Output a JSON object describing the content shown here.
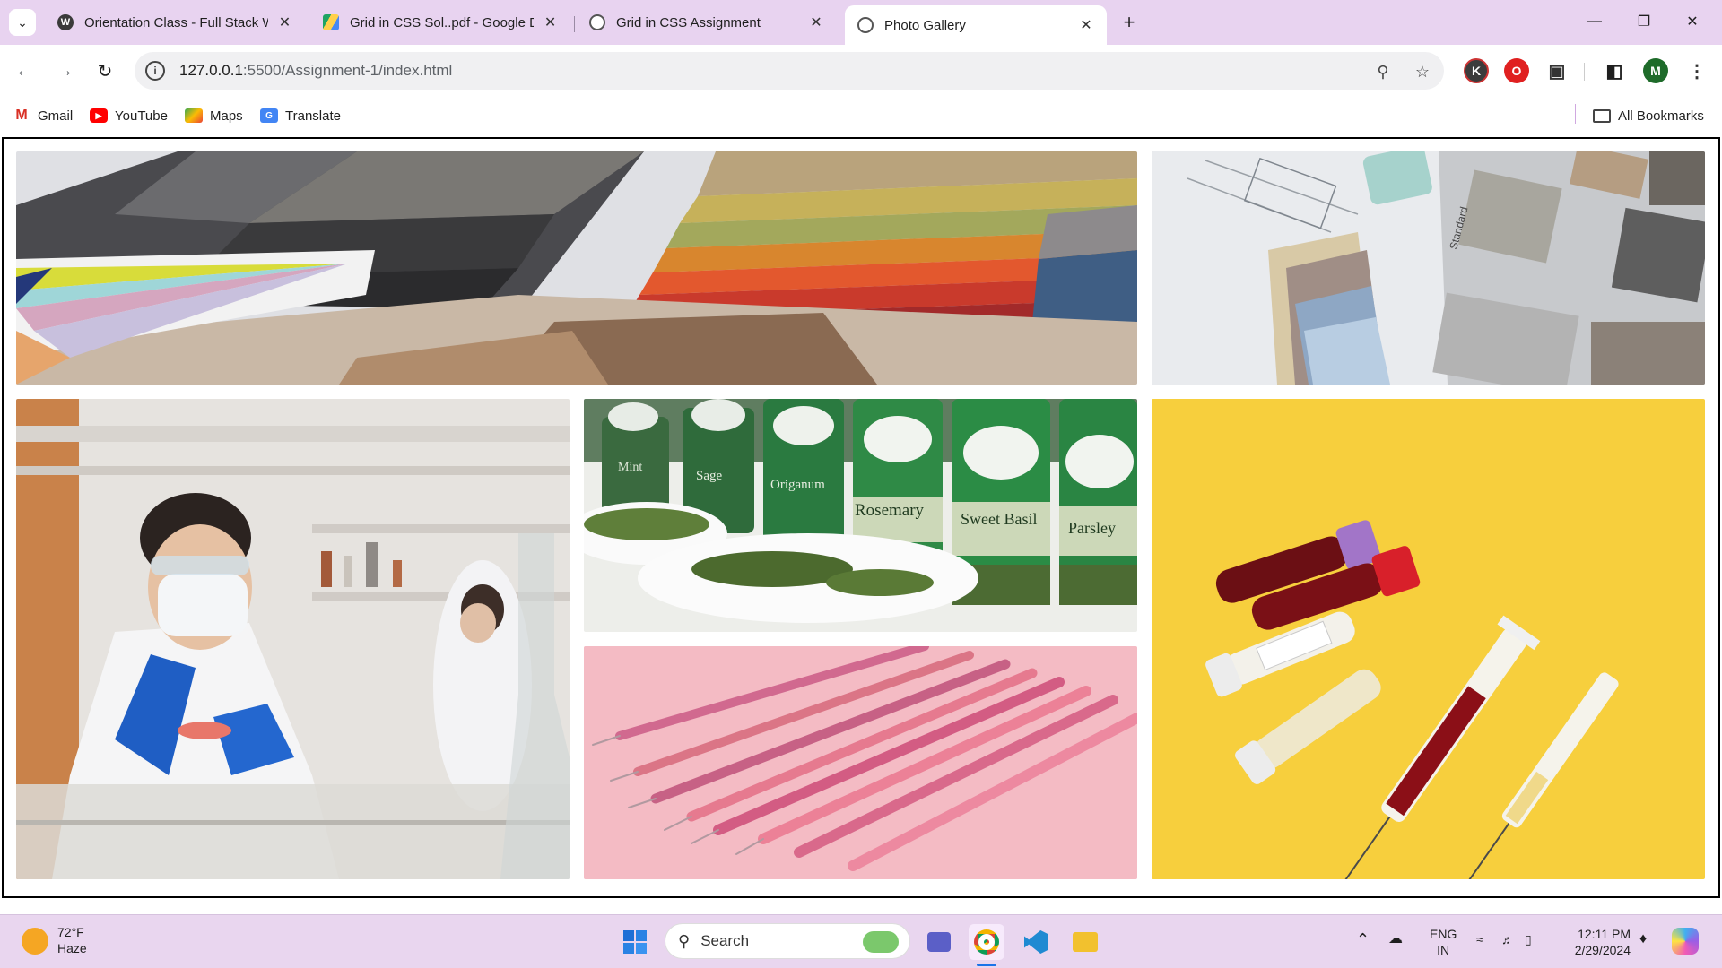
{
  "browser": {
    "tabs": [
      {
        "title": "Orientation Class - Full Stack W",
        "favicon": "wordpress-icon",
        "active": false
      },
      {
        "title": "Grid in CSS Sol..pdf - Google Dr",
        "favicon": "google-drive-icon",
        "active": false
      },
      {
        "title": "Grid in CSS Assignment",
        "favicon": "globe-icon",
        "active": false
      },
      {
        "title": "Photo Gallery",
        "favicon": "globe-icon",
        "active": true
      }
    ],
    "url_host": "127.0.0.1",
    "url_path": ":5500/Assignment-1/index.html",
    "profile_initial": "M",
    "extension_initial": "K"
  },
  "bookmarks": {
    "items": [
      "Gmail",
      "YouTube",
      "Maps",
      "Translate"
    ],
    "all_label": "All Bookmarks"
  },
  "gallery": {
    "photos": [
      {
        "subject": "fabric and paint color swatches"
      },
      {
        "subject": "interior material samples on blueprint"
      },
      {
        "subject": "scientist in laboratory"
      },
      {
        "subject": "spice jars with herbs"
      },
      {
        "subject": "syringes on pink background"
      },
      {
        "subject": "blood tubes and syringes on yellow background"
      }
    ],
    "spice_labels": [
      "Mint",
      "Sage",
      "Origanum",
      "Rosemary",
      "Sweet Basil",
      "Parsley"
    ],
    "swatch_labels": [
      "Standard"
    ]
  },
  "taskbar": {
    "weather_temp": "72°F",
    "weather_desc": "Haze",
    "search_placeholder": "Search",
    "lang_top": "ENG",
    "lang_bottom": "IN",
    "time": "12:11 PM",
    "date": "2/29/2024"
  },
  "colors": {
    "tabstrip": "#e8d3f0",
    "taskbar": "#e9d6ef",
    "omnibox": "#f0f0f2"
  }
}
